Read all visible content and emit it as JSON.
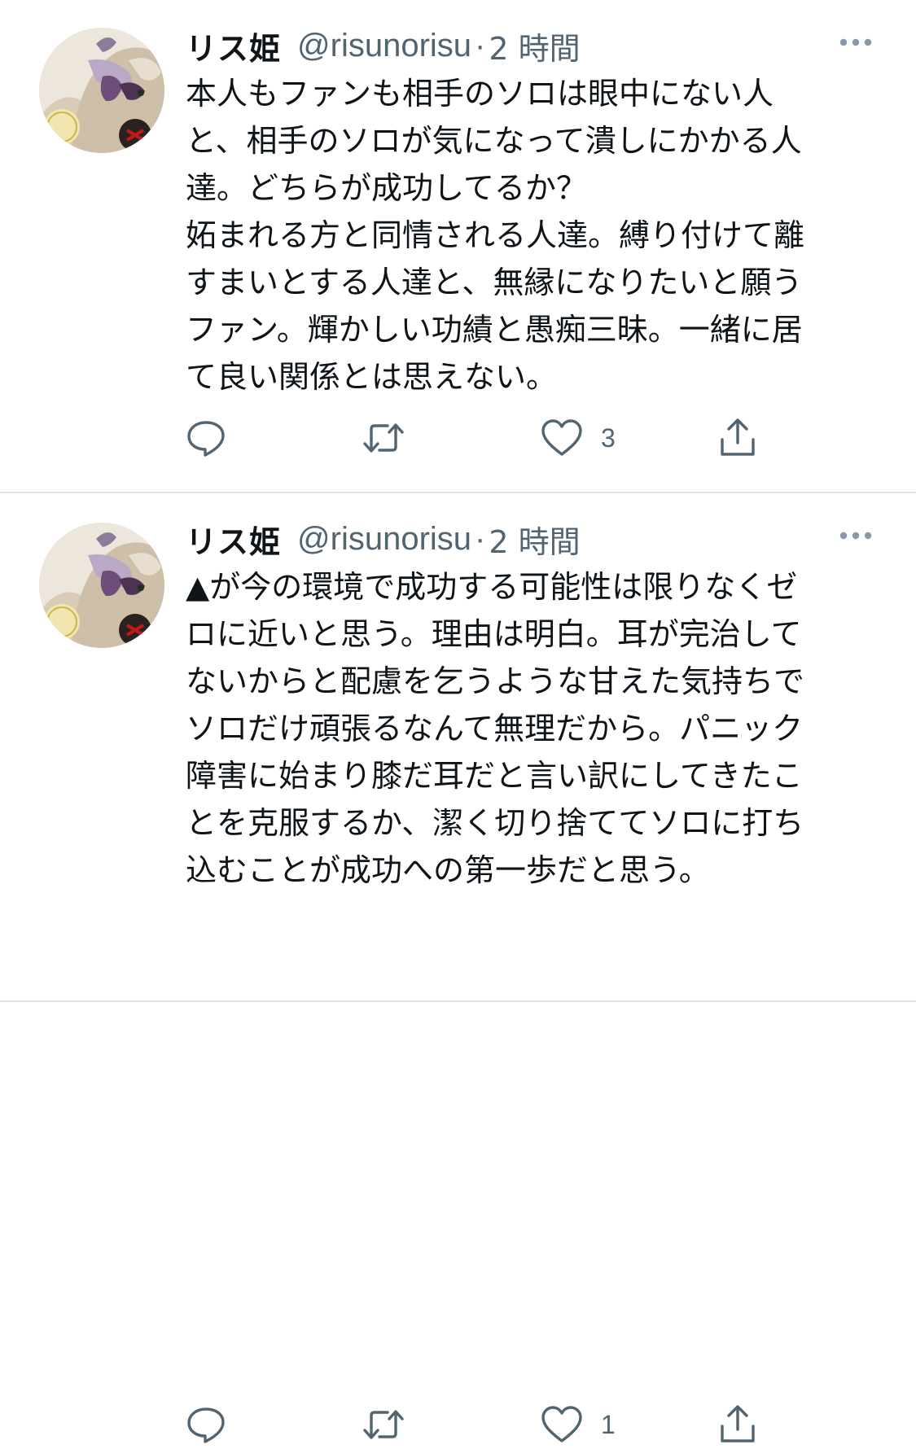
{
  "colors": {
    "text": "#0f1419",
    "secondary": "#536471",
    "divider": "#dfe3e6",
    "background": "#ffffff"
  },
  "tweets": [
    {
      "name": "リス姫",
      "handle": "@risunorisu",
      "separator": "·",
      "time": "2 時間",
      "text": "本人もファンも相手のソロは眼中にない人\nと、相手のソロが気になって潰しにかかる人\n達。どちらが成功してるか？\n妬まれる方と同情される人達。縛り付けて離\nすまいとする人達と、無縁になりたいと願う\nファン。輝かしい功績と愚痴三昧。一緒に居\nて良い関係とは思えない。",
      "like_count": "3",
      "icons": [
        "reply-icon",
        "retweet-icon",
        "like-icon",
        "share-icon",
        "more-icon"
      ]
    },
    {
      "name": "リス姫",
      "handle": "@risunorisu",
      "separator": "·",
      "time": "2 時間",
      "text": "▲が今の環境で成功する可能性は限りなくゼ\nロに近いと思う。理由は明白。耳が完治して\nないからと配慮を乞うような甘えた気持ちで\nソロだけ頑張るなんて無理だから。パニック\n障害に始まり膝だ耳だと言い訳にしてきたこ\nとを克服するか、潔く切り捨ててソロに打ち\n込むことが成功への第一歩だと思う。",
      "like_count": "1",
      "icons": [
        "reply-icon",
        "retweet-icon",
        "like-icon",
        "share-icon",
        "more-icon"
      ]
    }
  ]
}
